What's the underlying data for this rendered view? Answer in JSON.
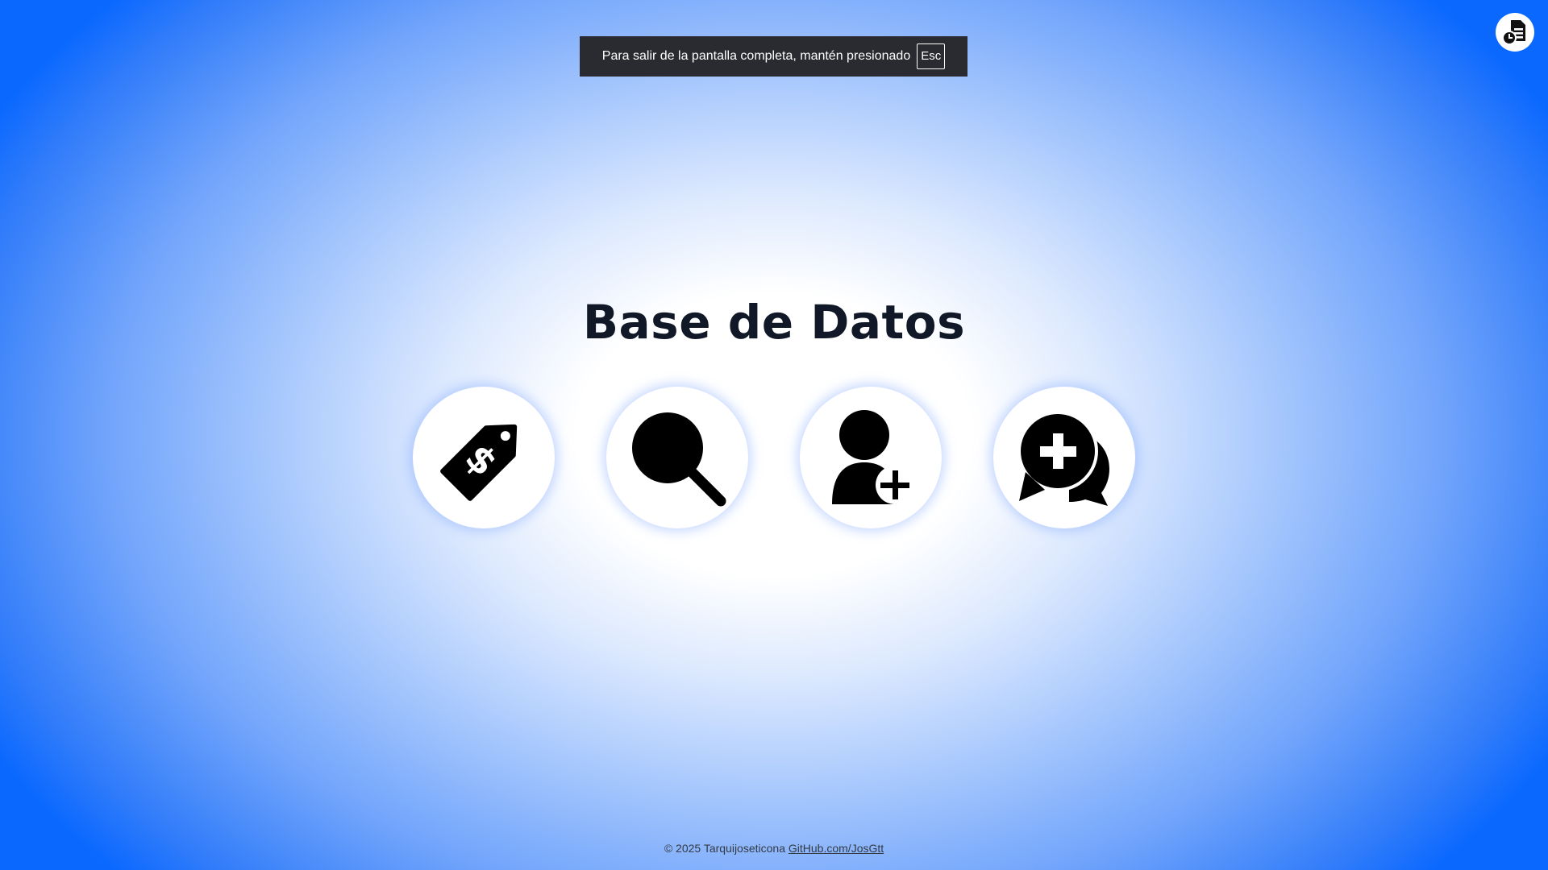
{
  "fullscreen_notice": {
    "message": "Para salir de la pantalla completa, mantén presionado",
    "key": "Esc"
  },
  "corner_button": {
    "icon": "document-clock-icon"
  },
  "page": {
    "title": "Base de Datos"
  },
  "actions": [
    {
      "icon": "price-tag-dollar-icon"
    },
    {
      "icon": "search-icon"
    },
    {
      "icon": "add-user-icon"
    },
    {
      "icon": "chat-add-icon"
    }
  ],
  "footer": {
    "copyright": "© 2025 Tarquijoseticona",
    "link_text": "GitHub.com/JosGtt"
  },
  "colors": {
    "background_center": "#ffffff",
    "background_edge": "#0a68ff",
    "title": "#111827",
    "toast_bg": "#2a2b30"
  }
}
